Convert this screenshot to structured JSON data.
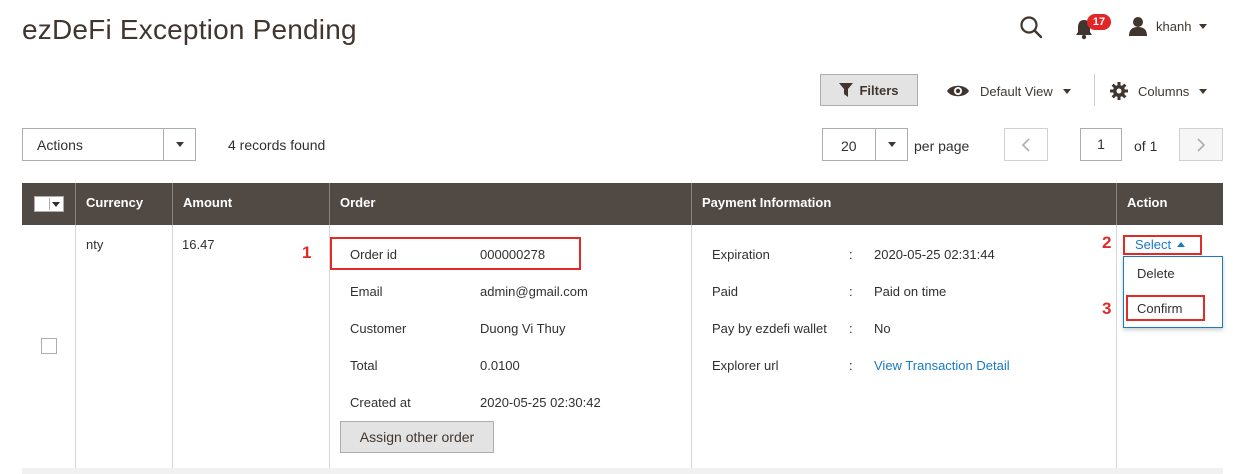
{
  "header": {
    "title": "ezDeFi Exception Pending",
    "notifications_count": "17",
    "user_name": "khanh"
  },
  "toolbar": {
    "filters_label": "Filters",
    "view_label": "Default View",
    "columns_label": "Columns"
  },
  "actions": {
    "label": "Actions",
    "records_text": "4 records found"
  },
  "pagination": {
    "per_page_value": "20",
    "per_page_label": "per page",
    "current_page": "1",
    "of_text": "of 1"
  },
  "columns": [
    "Currency",
    "Amount",
    "Order",
    "Payment Information",
    "Action"
  ],
  "row": {
    "currency": "nty",
    "amount": "16.47",
    "order": {
      "fields": [
        {
          "label": "Order id",
          "value": "000000278"
        },
        {
          "label": "Email",
          "value": "admin@gmail.com"
        },
        {
          "label": "Customer",
          "value": "Duong Vi Thuy"
        },
        {
          "label": "Total",
          "value": "0.0100"
        },
        {
          "label": "Created at",
          "value": "2020-05-25 02:30:42"
        }
      ],
      "assign_button": "Assign other order"
    },
    "payment": {
      "separator": ":",
      "fields": [
        {
          "label": "Expiration",
          "value": "2020-05-25 02:31:44"
        },
        {
          "label": "Paid",
          "value": "Paid on time"
        },
        {
          "label": "Pay by ezdefi wallet",
          "value": "No"
        },
        {
          "label": "Explorer url",
          "value": "View Transaction Detail"
        }
      ]
    },
    "action": {
      "select_label": "Select",
      "options": [
        "Delete",
        "Confirm"
      ]
    }
  },
  "annotations": [
    "1",
    "2",
    "3"
  ],
  "colors": {
    "header_bg": "#514943",
    "link": "#1979c3",
    "highlight": "#e02b27",
    "badge": "#e22626"
  }
}
